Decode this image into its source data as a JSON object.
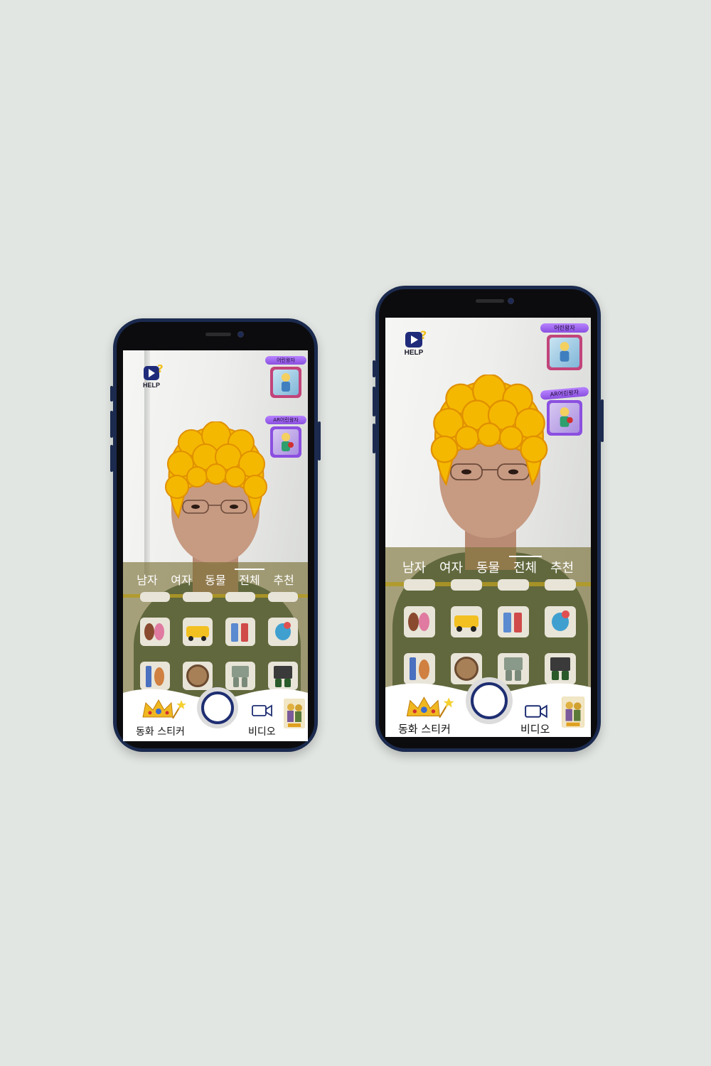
{
  "app": {
    "help_label": "HELP",
    "promos": [
      {
        "label": "어린왕자"
      },
      {
        "label": "AR어린왕자"
      }
    ],
    "tabs": [
      {
        "label": "남자",
        "active": false
      },
      {
        "label": "여자",
        "active": false
      },
      {
        "label": "동물",
        "active": false
      },
      {
        "label": "전체",
        "active": true
      },
      {
        "label": "추천",
        "active": false
      }
    ],
    "bottom_bar": {
      "sticker_label": "동화 스티커",
      "video_label": "비디오"
    },
    "icons": {
      "help": "help-play-icon",
      "sticker": "crown-wand-icon",
      "shutter": "shutter-button",
      "video": "video-camera-icon",
      "gallery": "gallery-thumbnail"
    },
    "colors": {
      "phone_frame": "#1b2a4e",
      "help_blue": "#1f2b7a",
      "promo_purple": "#9b5cf0",
      "sheet_olive": "#7a6a2c",
      "wig_yellow": "#f5b800",
      "shutter_ring": "#1e2e72"
    }
  }
}
